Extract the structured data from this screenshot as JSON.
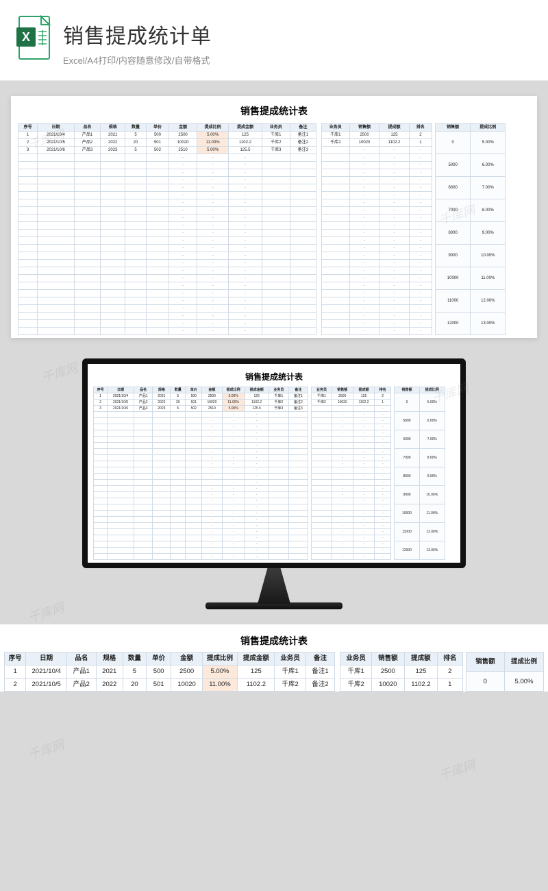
{
  "banner": {
    "title": "销售提成统计单",
    "subtitle": "Excel/A4打印/内容随意修改/自带格式"
  },
  "sheet": {
    "title": "销售提成统计表",
    "headers_main": [
      "序号",
      "日期",
      "品名",
      "规格",
      "数量",
      "单价",
      "金额",
      "提成比例",
      "提成金额",
      "业务员",
      "备注"
    ],
    "headers_summary": [
      "业务员",
      "销售额",
      "提成额",
      "排名"
    ],
    "headers_side": [
      "销售额",
      "提成比例"
    ],
    "rows": [
      {
        "c": [
          "1",
          "2021/10/4",
          "产品1",
          "2021",
          "5",
          "500",
          "2500",
          "5.00%",
          "125",
          "千库1",
          "备注1"
        ]
      },
      {
        "c": [
          "2",
          "2021/10/5",
          "产品2",
          "2022",
          "20",
          "501",
          "10020",
          "11.00%",
          "1102.2",
          "千库2",
          "备注2"
        ]
      },
      {
        "c": [
          "3",
          "2021/10/6",
          "产品3",
          "2023",
          "5",
          "502",
          "2510",
          "5.00%",
          "125.5",
          "千库3",
          "备注3"
        ]
      }
    ],
    "summary_rows": [
      {
        "c": [
          "千库1",
          "2500",
          "125",
          "2"
        ]
      },
      {
        "c": [
          "千库2",
          "10020",
          "1102.2",
          "1"
        ]
      }
    ],
    "side_rows": [
      {
        "c": [
          "0",
          "5.00%"
        ]
      },
      {
        "c": [
          "5000",
          "6.00%"
        ]
      },
      {
        "c": [
          "6000",
          "7.00%"
        ]
      },
      {
        "c": [
          "7000",
          "8.00%"
        ]
      },
      {
        "c": [
          "8000",
          "9.00%"
        ]
      },
      {
        "c": [
          "9000",
          "10.00%"
        ]
      },
      {
        "c": [
          "10000",
          "11.00%"
        ]
      },
      {
        "c": [
          "11000",
          "12.00%"
        ]
      },
      {
        "c": [
          "12000",
          "13.00%"
        ]
      }
    ],
    "empty_placeholder": "-",
    "empty_rows_count": 24,
    "highlight_col_index": 7
  },
  "watermark_text": "千库网"
}
